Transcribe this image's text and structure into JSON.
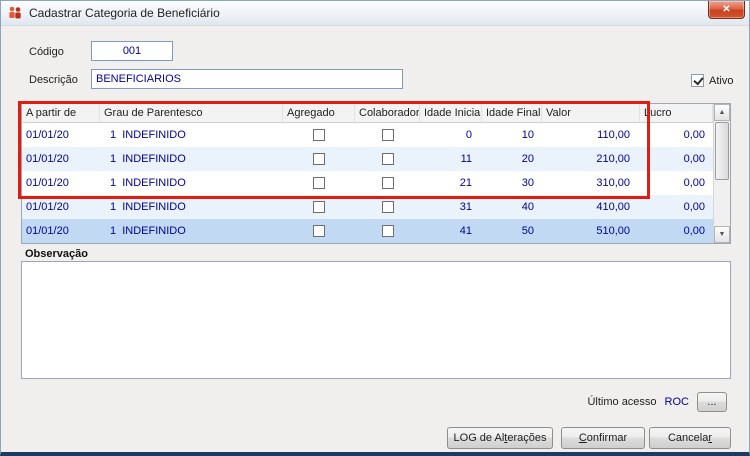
{
  "window": {
    "title": "Cadastrar Categoria de Beneficiário",
    "close_label": "✕"
  },
  "form": {
    "codigo": {
      "label": "Código",
      "value": "001"
    },
    "descricao": {
      "label": "Descrição",
      "value": "BENEFICIARIOS"
    },
    "ativo": {
      "label": "Ativo",
      "checked": true
    }
  },
  "grid": {
    "columns": [
      "A partir de",
      "Grau de Parentesco",
      "Agregado",
      "Colaborador",
      "Idade Inicial",
      "Idade Final",
      "Valor",
      "Lucro"
    ],
    "rows": [
      {
        "a_partir_de": "01/01/20",
        "grau_parentesco": "1  INDEFINIDO",
        "agregado": false,
        "colaborador": false,
        "idade_inicial": "0",
        "idade_final": "10",
        "valor": "110,00",
        "lucro": "0,00",
        "selected": false
      },
      {
        "a_partir_de": "01/01/20",
        "grau_parentesco": "1  INDEFINIDO",
        "agregado": false,
        "colaborador": false,
        "idade_inicial": "11",
        "idade_final": "20",
        "valor": "210,00",
        "lucro": "0,00",
        "selected": false
      },
      {
        "a_partir_de": "01/01/20",
        "grau_parentesco": "1  INDEFINIDO",
        "agregado": false,
        "colaborador": false,
        "idade_inicial": "21",
        "idade_final": "30",
        "valor": "310,00",
        "lucro": "0,00",
        "selected": false
      },
      {
        "a_partir_de": "01/01/20",
        "grau_parentesco": "1  INDEFINIDO",
        "agregado": false,
        "colaborador": false,
        "idade_inicial": "31",
        "idade_final": "40",
        "valor": "410,00",
        "lucro": "0,00",
        "selected": false
      },
      {
        "a_partir_de": "01/01/20",
        "grau_parentesco": "1  INDEFINIDO",
        "agregado": false,
        "colaborador": false,
        "idade_inicial": "41",
        "idade_final": "50",
        "valor": "510,00",
        "lucro": "0,00",
        "selected": true
      }
    ],
    "scrollbar": {
      "up_glyph": "▲",
      "down_glyph": "▼"
    }
  },
  "observacao": {
    "label": "Observação",
    "value": ""
  },
  "footer": {
    "ultimo_acesso": {
      "label": "Último acesso",
      "value": "ROC"
    },
    "browse_button": "...",
    "buttons": {
      "log": {
        "pre": "LOG de Al",
        "key": "t",
        "post": "erações"
      },
      "confirmar": {
        "pre": "",
        "key": "C",
        "post": "onfirmar"
      },
      "cancelar": {
        "pre": "Cancela",
        "key": "r",
        "post": ""
      }
    }
  },
  "annotation": {
    "color": "#e11d12",
    "note": "red rectangle highlighting header and first three grid rows"
  }
}
